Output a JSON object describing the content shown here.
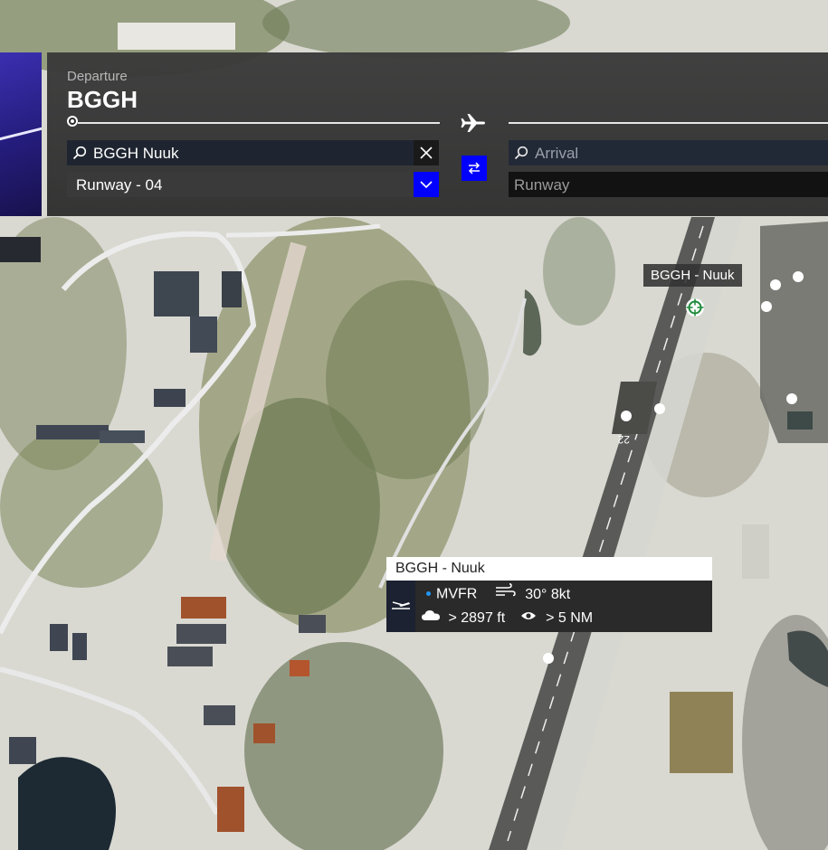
{
  "departure": {
    "label": "Departure",
    "code": "BGGH",
    "search_value": "BGGH Nuuk",
    "runway_value": "Runway - 04"
  },
  "arrival": {
    "search_placeholder": "Arrival",
    "runway_placeholder": "Runway"
  },
  "map": {
    "airport_label": "BGGH - Nuuk",
    "runway_number": "22"
  },
  "weather_card": {
    "title": "BGGH - Nuuk",
    "flight_category": "MVFR",
    "wind": "30° 8kt",
    "ceiling": "> 2897 ft",
    "visibility": "> 5 NM"
  },
  "colors": {
    "accent_button": "#0000ff",
    "mvfr_dot": "#2196f3",
    "airport_pin": "#1e8a3a"
  },
  "icons": {
    "search": "search-icon",
    "clear": "close-icon",
    "dropdown": "chevron-down-icon",
    "swap": "swap-arrows-icon",
    "route": "airplane-icon",
    "airport": "airport-pin-icon",
    "runway": "runway-icon",
    "wind": "wind-icon",
    "cloud": "cloud-icon",
    "visibility": "eye-icon"
  }
}
